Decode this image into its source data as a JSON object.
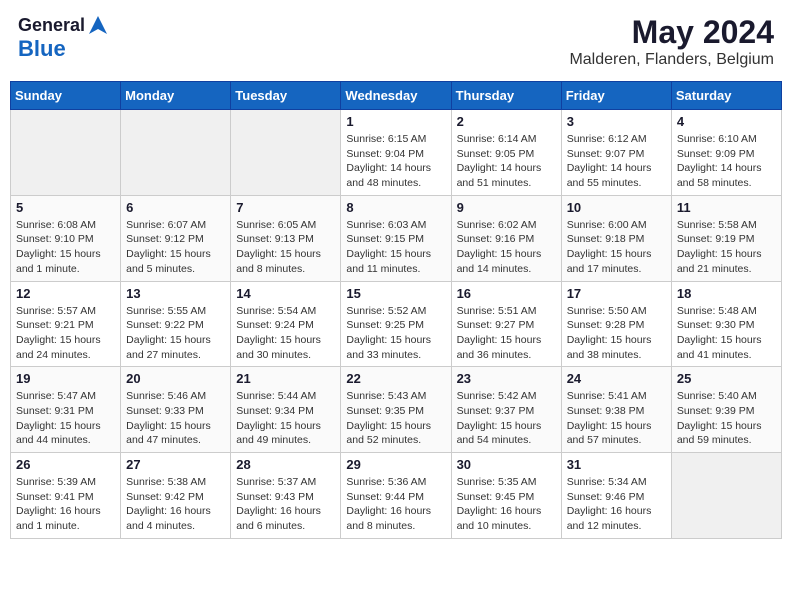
{
  "header": {
    "logo_general": "General",
    "logo_blue": "Blue",
    "month_year": "May 2024",
    "location": "Malderen, Flanders, Belgium"
  },
  "weekdays": [
    "Sunday",
    "Monday",
    "Tuesday",
    "Wednesday",
    "Thursday",
    "Friday",
    "Saturday"
  ],
  "weeks": [
    [
      {
        "day": "",
        "sunrise": "",
        "sunset": "",
        "daylight": ""
      },
      {
        "day": "",
        "sunrise": "",
        "sunset": "",
        "daylight": ""
      },
      {
        "day": "",
        "sunrise": "",
        "sunset": "",
        "daylight": ""
      },
      {
        "day": "1",
        "sunrise": "Sunrise: 6:15 AM",
        "sunset": "Sunset: 9:04 PM",
        "daylight": "Daylight: 14 hours and 48 minutes."
      },
      {
        "day": "2",
        "sunrise": "Sunrise: 6:14 AM",
        "sunset": "Sunset: 9:05 PM",
        "daylight": "Daylight: 14 hours and 51 minutes."
      },
      {
        "day": "3",
        "sunrise": "Sunrise: 6:12 AM",
        "sunset": "Sunset: 9:07 PM",
        "daylight": "Daylight: 14 hours and 55 minutes."
      },
      {
        "day": "4",
        "sunrise": "Sunrise: 6:10 AM",
        "sunset": "Sunset: 9:09 PM",
        "daylight": "Daylight: 14 hours and 58 minutes."
      }
    ],
    [
      {
        "day": "5",
        "sunrise": "Sunrise: 6:08 AM",
        "sunset": "Sunset: 9:10 PM",
        "daylight": "Daylight: 15 hours and 1 minute."
      },
      {
        "day": "6",
        "sunrise": "Sunrise: 6:07 AM",
        "sunset": "Sunset: 9:12 PM",
        "daylight": "Daylight: 15 hours and 5 minutes."
      },
      {
        "day": "7",
        "sunrise": "Sunrise: 6:05 AM",
        "sunset": "Sunset: 9:13 PM",
        "daylight": "Daylight: 15 hours and 8 minutes."
      },
      {
        "day": "8",
        "sunrise": "Sunrise: 6:03 AM",
        "sunset": "Sunset: 9:15 PM",
        "daylight": "Daylight: 15 hours and 11 minutes."
      },
      {
        "day": "9",
        "sunrise": "Sunrise: 6:02 AM",
        "sunset": "Sunset: 9:16 PM",
        "daylight": "Daylight: 15 hours and 14 minutes."
      },
      {
        "day": "10",
        "sunrise": "Sunrise: 6:00 AM",
        "sunset": "Sunset: 9:18 PM",
        "daylight": "Daylight: 15 hours and 17 minutes."
      },
      {
        "day": "11",
        "sunrise": "Sunrise: 5:58 AM",
        "sunset": "Sunset: 9:19 PM",
        "daylight": "Daylight: 15 hours and 21 minutes."
      }
    ],
    [
      {
        "day": "12",
        "sunrise": "Sunrise: 5:57 AM",
        "sunset": "Sunset: 9:21 PM",
        "daylight": "Daylight: 15 hours and 24 minutes."
      },
      {
        "day": "13",
        "sunrise": "Sunrise: 5:55 AM",
        "sunset": "Sunset: 9:22 PM",
        "daylight": "Daylight: 15 hours and 27 minutes."
      },
      {
        "day": "14",
        "sunrise": "Sunrise: 5:54 AM",
        "sunset": "Sunset: 9:24 PM",
        "daylight": "Daylight: 15 hours and 30 minutes."
      },
      {
        "day": "15",
        "sunrise": "Sunrise: 5:52 AM",
        "sunset": "Sunset: 9:25 PM",
        "daylight": "Daylight: 15 hours and 33 minutes."
      },
      {
        "day": "16",
        "sunrise": "Sunrise: 5:51 AM",
        "sunset": "Sunset: 9:27 PM",
        "daylight": "Daylight: 15 hours and 36 minutes."
      },
      {
        "day": "17",
        "sunrise": "Sunrise: 5:50 AM",
        "sunset": "Sunset: 9:28 PM",
        "daylight": "Daylight: 15 hours and 38 minutes."
      },
      {
        "day": "18",
        "sunrise": "Sunrise: 5:48 AM",
        "sunset": "Sunset: 9:30 PM",
        "daylight": "Daylight: 15 hours and 41 minutes."
      }
    ],
    [
      {
        "day": "19",
        "sunrise": "Sunrise: 5:47 AM",
        "sunset": "Sunset: 9:31 PM",
        "daylight": "Daylight: 15 hours and 44 minutes."
      },
      {
        "day": "20",
        "sunrise": "Sunrise: 5:46 AM",
        "sunset": "Sunset: 9:33 PM",
        "daylight": "Daylight: 15 hours and 47 minutes."
      },
      {
        "day": "21",
        "sunrise": "Sunrise: 5:44 AM",
        "sunset": "Sunset: 9:34 PM",
        "daylight": "Daylight: 15 hours and 49 minutes."
      },
      {
        "day": "22",
        "sunrise": "Sunrise: 5:43 AM",
        "sunset": "Sunset: 9:35 PM",
        "daylight": "Daylight: 15 hours and 52 minutes."
      },
      {
        "day": "23",
        "sunrise": "Sunrise: 5:42 AM",
        "sunset": "Sunset: 9:37 PM",
        "daylight": "Daylight: 15 hours and 54 minutes."
      },
      {
        "day": "24",
        "sunrise": "Sunrise: 5:41 AM",
        "sunset": "Sunset: 9:38 PM",
        "daylight": "Daylight: 15 hours and 57 minutes."
      },
      {
        "day": "25",
        "sunrise": "Sunrise: 5:40 AM",
        "sunset": "Sunset: 9:39 PM",
        "daylight": "Daylight: 15 hours and 59 minutes."
      }
    ],
    [
      {
        "day": "26",
        "sunrise": "Sunrise: 5:39 AM",
        "sunset": "Sunset: 9:41 PM",
        "daylight": "Daylight: 16 hours and 1 minute."
      },
      {
        "day": "27",
        "sunrise": "Sunrise: 5:38 AM",
        "sunset": "Sunset: 9:42 PM",
        "daylight": "Daylight: 16 hours and 4 minutes."
      },
      {
        "day": "28",
        "sunrise": "Sunrise: 5:37 AM",
        "sunset": "Sunset: 9:43 PM",
        "daylight": "Daylight: 16 hours and 6 minutes."
      },
      {
        "day": "29",
        "sunrise": "Sunrise: 5:36 AM",
        "sunset": "Sunset: 9:44 PM",
        "daylight": "Daylight: 16 hours and 8 minutes."
      },
      {
        "day": "30",
        "sunrise": "Sunrise: 5:35 AM",
        "sunset": "Sunset: 9:45 PM",
        "daylight": "Daylight: 16 hours and 10 minutes."
      },
      {
        "day": "31",
        "sunrise": "Sunrise: 5:34 AM",
        "sunset": "Sunset: 9:46 PM",
        "daylight": "Daylight: 16 hours and 12 minutes."
      },
      {
        "day": "",
        "sunrise": "",
        "sunset": "",
        "daylight": ""
      }
    ]
  ]
}
